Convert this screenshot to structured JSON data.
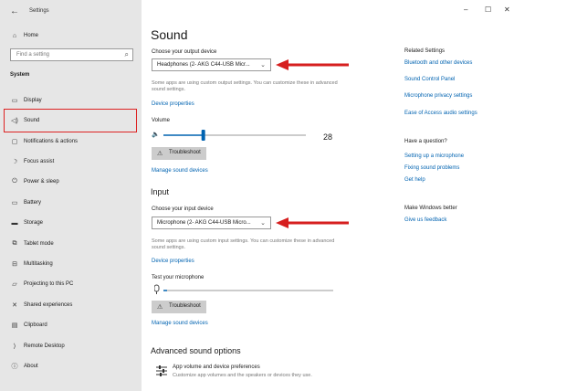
{
  "window": {
    "title": "Settings",
    "back_glyph": "←",
    "controls": {
      "minimize": "–",
      "maximize": "☐",
      "close": "✕"
    }
  },
  "sidebar": {
    "home": {
      "label": "Home",
      "icon": "⌂"
    },
    "search": {
      "placeholder": "Find a setting",
      "icon": "⌕"
    },
    "section_label": "System",
    "items": [
      {
        "label": "Display",
        "icon": "▭"
      },
      {
        "label": "Sound",
        "icon": "◁)"
      },
      {
        "label": "Notifications & actions",
        "icon": "▢"
      },
      {
        "label": "Focus assist",
        "icon": "☽"
      },
      {
        "label": "Power & sleep",
        "icon": "⏻"
      },
      {
        "label": "Battery",
        "icon": "▭"
      },
      {
        "label": "Storage",
        "icon": "▬"
      },
      {
        "label": "Tablet mode",
        "icon": "⧉"
      },
      {
        "label": "Multitasking",
        "icon": "⊟"
      },
      {
        "label": "Projecting to this PC",
        "icon": "▱"
      },
      {
        "label": "Shared experiences",
        "icon": "✕"
      },
      {
        "label": "Clipboard",
        "icon": "▤"
      },
      {
        "label": "Remote Desktop",
        "icon": "⟩"
      },
      {
        "label": "About",
        "icon": "ⓘ"
      }
    ]
  },
  "main": {
    "title": "Sound",
    "output": {
      "choose_label": "Choose your output device",
      "device": "Headphones (2- AKG C44-USB Micr...",
      "info": "Some apps are using custom output settings. You can customize these in advanced sound settings.",
      "device_properties": "Device properties",
      "volume_label": "Volume",
      "volume_value": "28",
      "volume_level": 0.28,
      "troubleshoot": "Troubleshoot",
      "manage": "Manage sound devices"
    },
    "input": {
      "heading": "Input",
      "choose_label": "Choose your input device",
      "device": "Microphone (2- AKG C44-USB Micro...",
      "info": "Some apps are using custom input settings. You can customize these in advanced sound settings.",
      "device_properties": "Device properties",
      "test_label": "Test your microphone",
      "troubleshoot": "Troubleshoot",
      "manage": "Manage sound devices"
    },
    "advanced": {
      "heading": "Advanced sound options",
      "item_title": "App volume and device preferences",
      "item_desc": "Customize app volumes and the speakers or devices they use."
    }
  },
  "related": {
    "heading": "Related Settings",
    "links": [
      "Bluetooth and other devices",
      "Sound Control Panel",
      "Microphone privacy settings",
      "Ease of Access audio settings"
    ],
    "question_heading": "Have a question?",
    "question_links": [
      "Setting up a microphone",
      "Fixing sound problems",
      "Get help"
    ],
    "better_heading": "Make Windows better",
    "feedback": "Give us feedback"
  },
  "colors": {
    "accent": "#0063b1",
    "annotation": "#d61f1f",
    "sidebar_bg": "#e6e6e6"
  }
}
